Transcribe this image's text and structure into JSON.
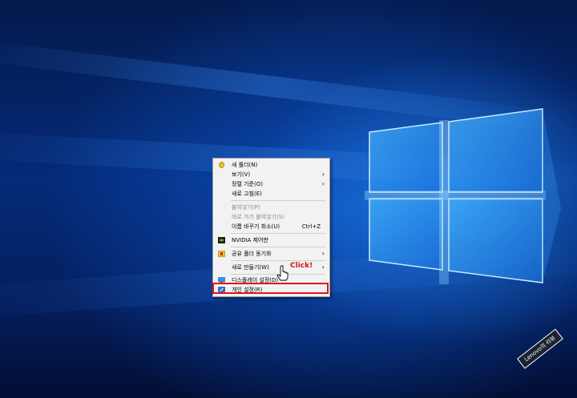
{
  "menu": {
    "items": [
      {
        "label": "새 폴더(N)",
        "icon": "new-folder-icon",
        "enabled": true
      },
      {
        "label": "보기(V)",
        "submenu": true,
        "enabled": true
      },
      {
        "label": "정렬 기준(O)",
        "submenu": true,
        "enabled": true
      },
      {
        "label": "새로 고침(E)",
        "enabled": true
      },
      {
        "label": "붙여넣기(P)",
        "enabled": false
      },
      {
        "label": "바로 가기 붙여넣기(S)",
        "enabled": false
      },
      {
        "label": "이름 바꾸기 취소(U)",
        "shortcut": "Ctrl+Z",
        "enabled": true
      },
      {
        "label": "NVIDIA 제어판",
        "icon": "nvidia-icon",
        "enabled": true
      },
      {
        "label": "공유 폴더 동기화",
        "icon": "sync-folder-icon",
        "submenu": true,
        "enabled": true
      },
      {
        "label": "새로 만들기(W)",
        "submenu": true,
        "enabled": true
      },
      {
        "label": "디스플레이 설정(D)",
        "icon": "display-icon",
        "enabled": true
      },
      {
        "label": "개인 설정(R)",
        "icon": "personalize-icon",
        "enabled": true
      }
    ],
    "highlighted_item": "개인 설정(R)"
  },
  "annotation": {
    "click_text": "Click!",
    "highlight_color": "#e0141e"
  },
  "watermark": {
    "text": "Lenovo의 리뷰"
  },
  "colors": {
    "desktop_blue": "#0a4fc4",
    "logo_light": "#6fd0ff"
  }
}
